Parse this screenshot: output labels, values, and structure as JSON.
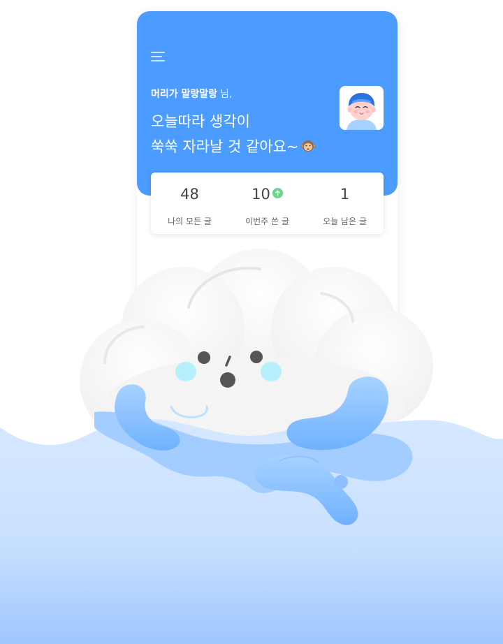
{
  "header": {
    "menu_icon": "hamburger-menu-icon",
    "user_name": "머리가 말랑말랑",
    "user_suffix": "님,",
    "greeting_line1": "오늘따라 생각이",
    "greeting_line2": "쑥쑥 자라날 것 같아요~",
    "greeting_emoji": "monkey-face-emoji",
    "avatar_icon": "user-avatar-boy-icon"
  },
  "stats": [
    {
      "value": "48",
      "label": "나의 모든 글"
    },
    {
      "value": "10",
      "label": "이번주 쓴 글",
      "badge": "arrow-up-icon"
    },
    {
      "value": "1",
      "label": "오늘 남은 글"
    }
  ],
  "colors": {
    "header_bg": "#4c9bff",
    "badge_green": "#6fd38f",
    "water_light": "#d3e6ff",
    "water_deep": "#9cc6ff",
    "cloud_blush": "#b8f2fb"
  },
  "illustration": {
    "character": "cloud-mascot",
    "background": "water-waves"
  }
}
